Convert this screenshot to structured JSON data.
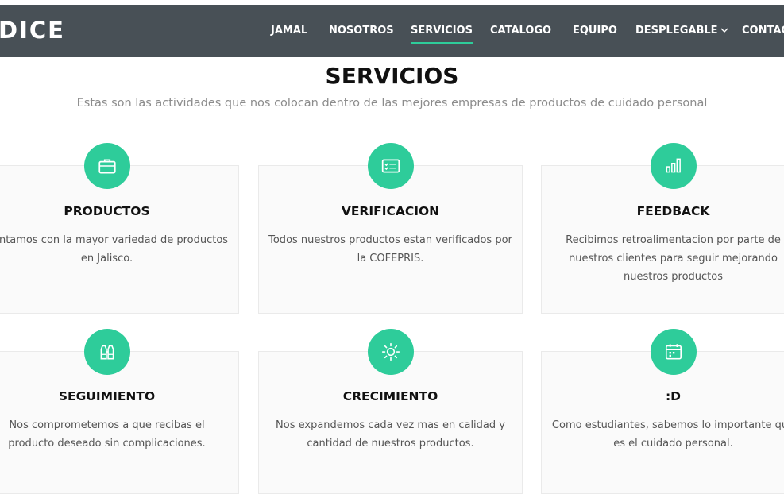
{
  "nav": {
    "brand": "DICE",
    "items": [
      {
        "label": "JAMAL"
      },
      {
        "label": "NOSOTROS"
      },
      {
        "label": "SERVICIOS"
      },
      {
        "label": "CATALOGO"
      },
      {
        "label": "EQUIPO"
      },
      {
        "label": "DESPLEGABLE"
      },
      {
        "label": "CONTACTO"
      }
    ]
  },
  "section": {
    "title": "SERVICIOS",
    "subtitle": "Estas son las actividades que nos colocan dentro de las mejores empresas de productos de cuidado personal"
  },
  "services": [
    {
      "icon": "briefcase-icon",
      "title": "PRODUCTOS",
      "text": "Contamos con la mayor variedad de productos en Jalisco."
    },
    {
      "icon": "card-checklist-icon",
      "title": "VERIFICACION",
      "text": "Todos nuestros productos estan verificados por la COFEPRIS."
    },
    {
      "icon": "bar-chart-icon",
      "title": "FEEDBACK",
      "text": "Recibimos retroalimentacion por parte de nuestros clientes para seguir mejorando nuestros productos"
    },
    {
      "icon": "binoculars-icon",
      "title": "SEGUIMIENTO",
      "text": "Nos comprometemos a que recibas el producto deseado sin complicaciones."
    },
    {
      "icon": "sun-icon",
      "title": "CRECIMIENTO",
      "text": "Nos expandemos cada vez mas en calidad y cantidad de nuestros productos."
    },
    {
      "icon": "calendar-icon",
      "title": ":D",
      "text": "Como estudiantes, sabemos lo importante que es el cuidado personal."
    }
  ],
  "colors": {
    "navbar": "#485056",
    "accent": "#2ecc9a"
  }
}
